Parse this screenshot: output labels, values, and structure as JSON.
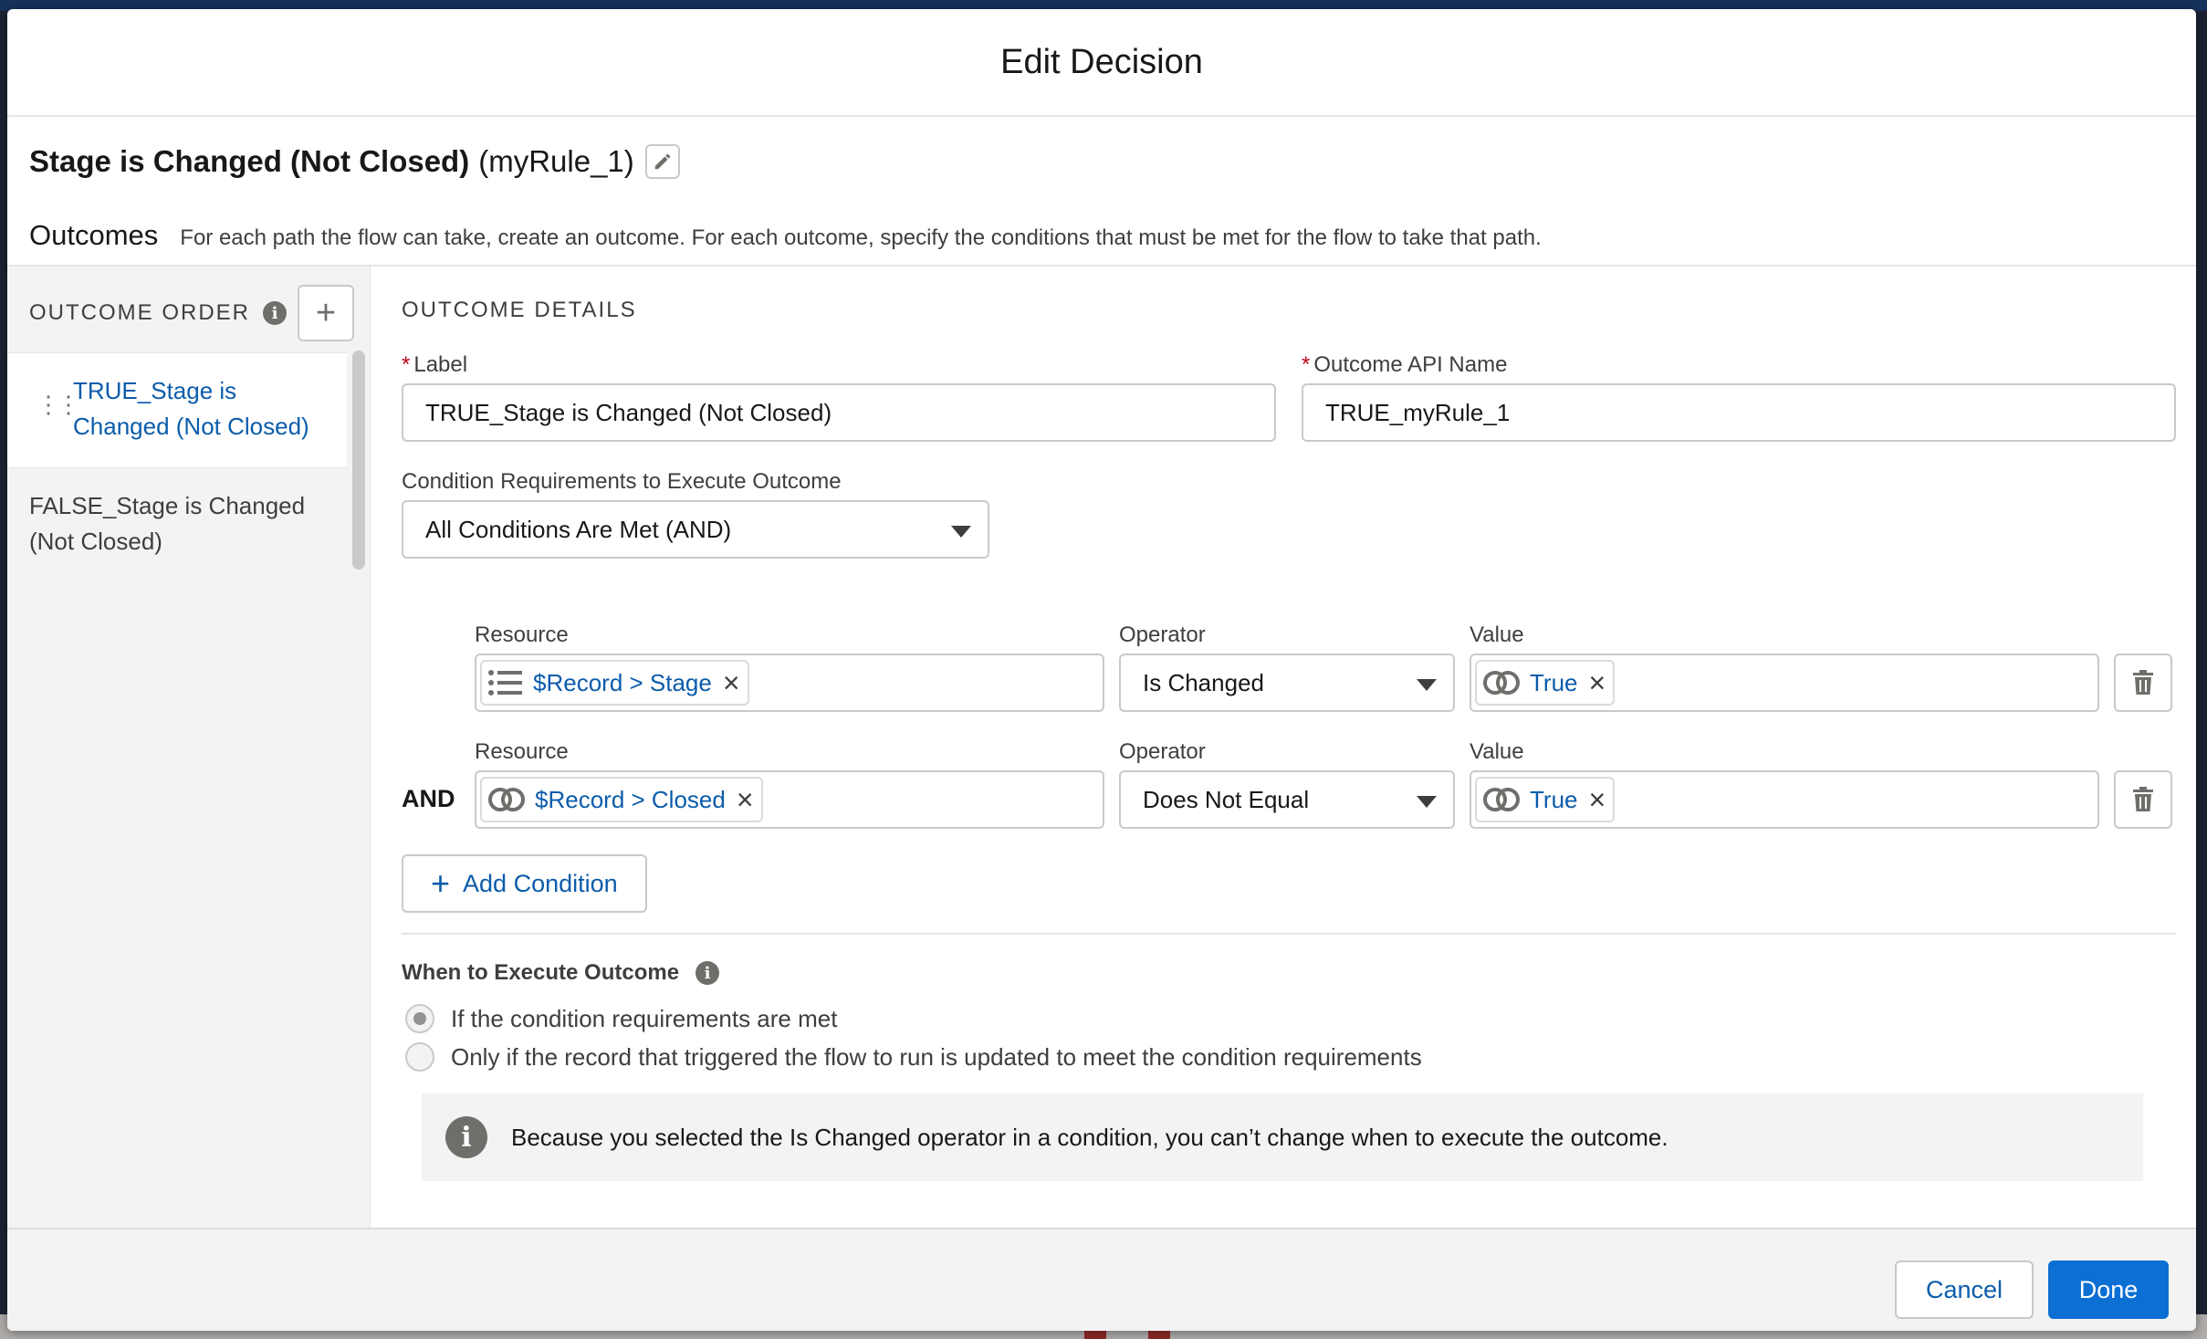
{
  "modal": {
    "title": "Edit Decision"
  },
  "rule": {
    "name": "Stage is Changed (Not Closed)",
    "api_name": "(myRule_1)"
  },
  "outcomes": {
    "title": "Outcomes",
    "description": "For each path the flow can take, create an outcome. For each outcome, specify the conditions that must be met for the flow to take that path."
  },
  "outcome_order": {
    "label": "OUTCOME ORDER",
    "items": [
      {
        "label": "TRUE_Stage is Changed (Not Closed)",
        "selected": true
      },
      {
        "label": "FALSE_Stage is Changed (Not Closed)",
        "selected": false
      }
    ]
  },
  "details": {
    "heading": "OUTCOME DETAILS",
    "label_field": {
      "label": "Label",
      "value": "TRUE_Stage is Changed (Not Closed)"
    },
    "api_field": {
      "label": "Outcome API Name",
      "value": "TRUE_myRule_1"
    },
    "condition_req": {
      "label": "Condition Requirements to Execute Outcome",
      "value": "All Conditions Are Met (AND)"
    },
    "conditions": [
      {
        "resource_label": "Resource",
        "resource": "$Record > Stage",
        "operator_label": "Operator",
        "operator": "Is Changed",
        "value_label": "Value",
        "value": "True"
      },
      {
        "connector": "AND",
        "resource_label": "Resource",
        "resource": "$Record > Closed",
        "operator_label": "Operator",
        "operator": "Does Not Equal",
        "value_label": "Value",
        "value": "True"
      }
    ],
    "add_condition": "Add Condition",
    "when_execute": {
      "heading": "When to Execute Outcome",
      "options": [
        {
          "label": "If the condition requirements are met",
          "selected": true
        },
        {
          "label": "Only if the record that triggered the flow to run is updated to meet the condition requirements",
          "selected": false
        }
      ],
      "notice": "Because you selected the Is Changed operator in a condition, you can’t change when to execute the outcome."
    }
  },
  "footer": {
    "cancel": "Cancel",
    "done": "Done"
  },
  "colors": {
    "brand": "#0b6fd4",
    "link": "#0b5cab",
    "required": "#ba0517"
  }
}
